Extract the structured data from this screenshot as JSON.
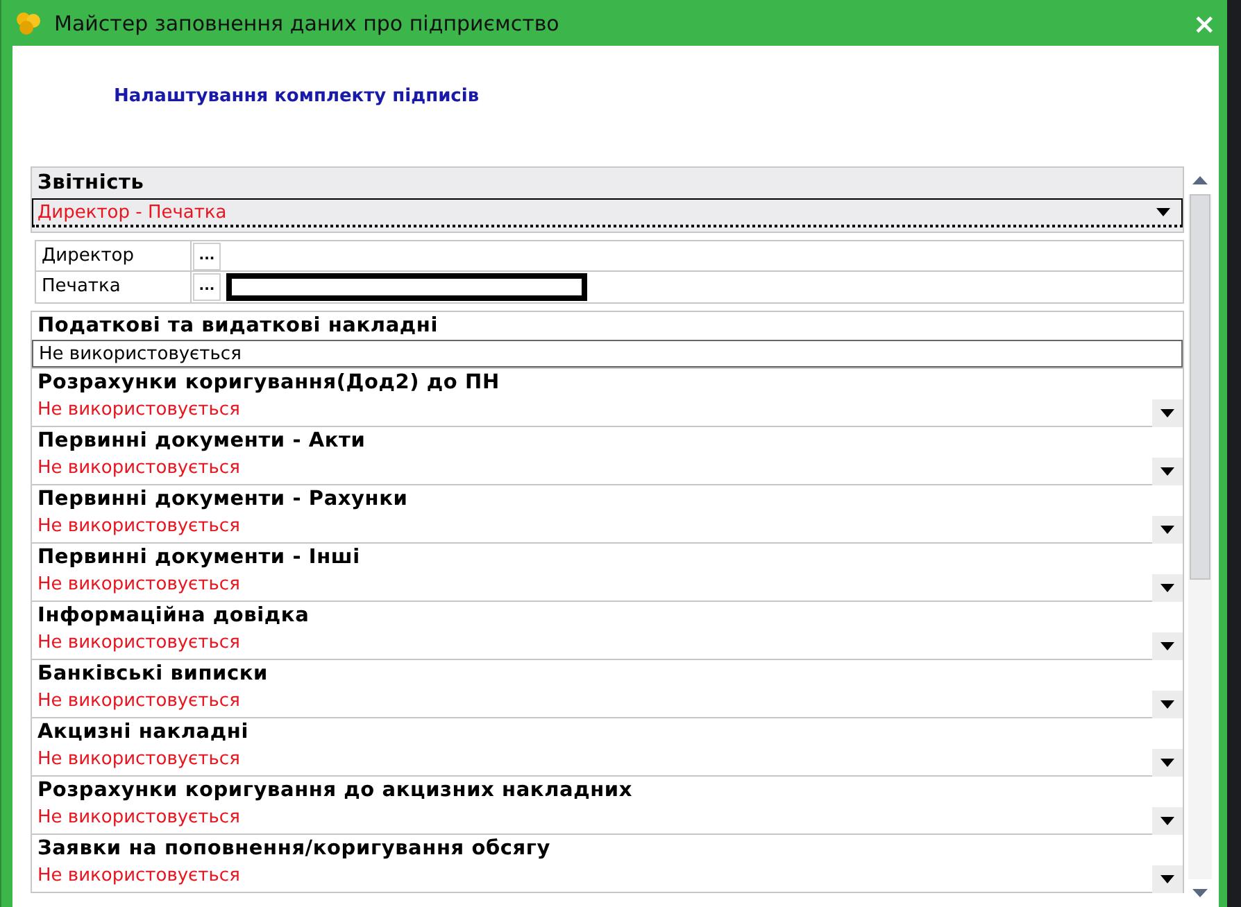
{
  "window": {
    "title": "Майстер заповнення даних про підприємство",
    "close": "×"
  },
  "subtitle": "Налаштування комплекту підписів",
  "reporting": {
    "title": "Звітність",
    "value": "Директор - Печатка",
    "signers": [
      {
        "label": "Директор",
        "button": "..."
      },
      {
        "label": "Печатка",
        "button": "...",
        "focused": true
      }
    ]
  },
  "sections": [
    {
      "title": "Податкові та видаткові накладні",
      "value": "Не використовується",
      "kind": "text"
    },
    {
      "title": "Розрахунки коригування(Дод2) до ПН",
      "value": "Не використовується",
      "kind": "dropdown"
    },
    {
      "title": "Первинні документи - Акти",
      "value": "Не використовується",
      "kind": "dropdown"
    },
    {
      "title": "Первинні документи - Рахунки",
      "value": "Не використовується",
      "kind": "dropdown"
    },
    {
      "title": "Первинні документи - Інші",
      "value": "Не використовується",
      "kind": "dropdown"
    },
    {
      "title": "Інформаційна довідка",
      "value": "Не використовується",
      "kind": "dropdown"
    },
    {
      "title": "Банківські виписки",
      "value": "Не використовується",
      "kind": "dropdown"
    },
    {
      "title": "Акцизні накладні",
      "value": "Не використовується",
      "kind": "dropdown"
    },
    {
      "title": "Розрахунки коригування до акцизних накладних",
      "value": "Не використовується",
      "kind": "dropdown"
    },
    {
      "title": "Заявки на поповнення/коригування обсягу",
      "value": "Не використовується",
      "kind": "dropdown"
    }
  ]
}
